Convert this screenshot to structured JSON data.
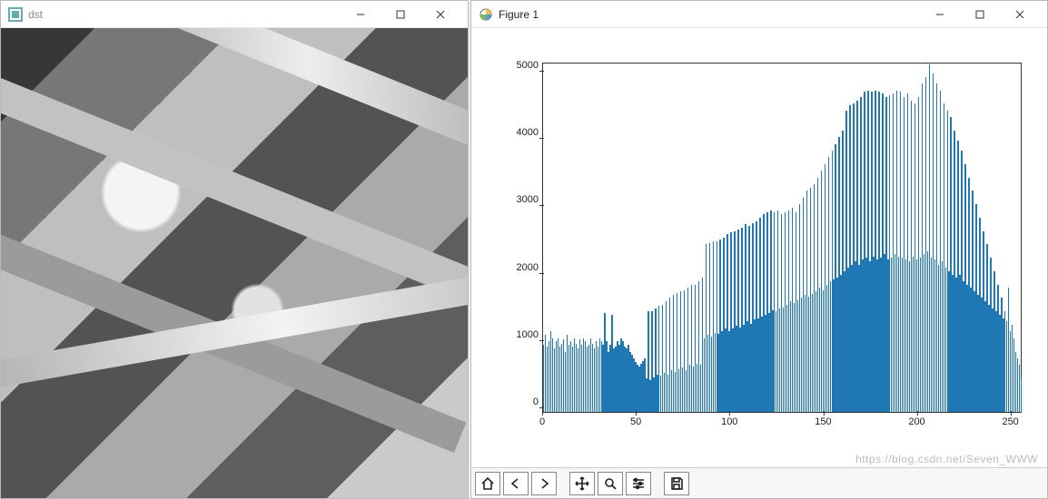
{
  "left_window": {
    "title": "dst",
    "icon_name": "opencv-window-icon"
  },
  "right_window": {
    "title": "Figure 1",
    "icon_name": "matplotlib-figure-icon"
  },
  "window_controls": {
    "minimize": "Minimize",
    "maximize": "Maximize",
    "close": "Close"
  },
  "toolbar": {
    "home": "Home",
    "back": "Back",
    "forward": "Forward",
    "pan": "Pan",
    "zoom": "Zoom",
    "configure": "Configure subplots",
    "save": "Save"
  },
  "watermark": "https://blog.csdn.net/Seven_WWW",
  "chart_data": {
    "type": "bar",
    "title": "",
    "xlabel": "",
    "ylabel": "",
    "xlim": [
      0,
      256
    ],
    "ylim": [
      0,
      5200
    ],
    "xticks": [
      0,
      50,
      100,
      150,
      200,
      250
    ],
    "yticks": [
      0,
      1000,
      2000,
      3000,
      4000,
      5000
    ],
    "x": [
      0,
      1,
      2,
      3,
      4,
      5,
      6,
      7,
      8,
      9,
      10,
      11,
      12,
      13,
      14,
      15,
      16,
      17,
      18,
      19,
      20,
      21,
      22,
      23,
      24,
      25,
      26,
      27,
      28,
      29,
      30,
      31,
      32,
      33,
      34,
      35,
      36,
      37,
      38,
      39,
      40,
      41,
      42,
      43,
      44,
      45,
      46,
      47,
      48,
      49,
      50,
      51,
      52,
      53,
      54,
      55,
      56,
      57,
      58,
      59,
      60,
      61,
      62,
      63,
      64,
      65,
      66,
      67,
      68,
      69,
      70,
      71,
      72,
      73,
      74,
      75,
      76,
      77,
      78,
      79,
      80,
      81,
      82,
      83,
      84,
      85,
      86,
      87,
      88,
      89,
      90,
      91,
      92,
      93,
      94,
      95,
      96,
      97,
      98,
      99,
      100,
      101,
      102,
      103,
      104,
      105,
      106,
      107,
      108,
      109,
      110,
      111,
      112,
      113,
      114,
      115,
      116,
      117,
      118,
      119,
      120,
      121,
      122,
      123,
      124,
      125,
      126,
      127,
      128,
      129,
      130,
      131,
      132,
      133,
      134,
      135,
      136,
      137,
      138,
      139,
      140,
      141,
      142,
      143,
      144,
      145,
      146,
      147,
      148,
      149,
      150,
      151,
      152,
      153,
      154,
      155,
      156,
      157,
      158,
      159,
      160,
      161,
      162,
      163,
      164,
      165,
      166,
      167,
      168,
      169,
      170,
      171,
      172,
      173,
      174,
      175,
      176,
      177,
      178,
      179,
      180,
      181,
      182,
      183,
      184,
      185,
      186,
      187,
      188,
      189,
      190,
      191,
      192,
      193,
      194,
      195,
      196,
      197,
      198,
      199,
      200,
      201,
      202,
      203,
      204,
      205,
      206,
      207,
      208,
      209,
      210,
      211,
      212,
      213,
      214,
      215,
      216,
      217,
      218,
      219,
      220,
      221,
      222,
      223,
      224,
      225,
      226,
      227,
      228,
      229,
      230,
      231,
      232,
      233,
      234,
      235,
      236,
      237,
      238,
      239,
      240,
      241,
      242,
      243,
      244,
      245,
      246,
      247,
      248,
      249,
      250,
      251,
      252,
      253,
      254,
      255
    ],
    "values": [
      1000,
      1150,
      980,
      1050,
      1200,
      1100,
      950,
      1050,
      1100,
      970,
      1020,
      1080,
      900,
      1150,
      1000,
      1050,
      980,
      1100,
      1020,
      950,
      1080,
      1000,
      1100,
      1050,
      980,
      1000,
      1100,
      1020,
      950,
      1050,
      980,
      1100,
      1050,
      1000,
      1480,
      1050,
      900,
      1000,
      1450,
      950,
      980,
      1050,
      1000,
      1100,
      1050,
      980,
      950,
      1000,
      900,
      850,
      800,
      750,
      700,
      680,
      720,
      760,
      800,
      500,
      1500,
      480,
      1500,
      520,
      1550,
      560,
      1580,
      540,
      1600,
      580,
      1650,
      560,
      1700,
      620,
      1750,
      600,
      1780,
      640,
      1800,
      660,
      1820,
      620,
      1850,
      700,
      1900,
      680,
      1900,
      720,
      1950,
      700,
      2000,
      1100,
      2500,
      1150,
      2520,
      1120,
      2540,
      1180,
      2550,
      1160,
      2570,
      1200,
      2600,
      1250,
      2650,
      1200,
      2680,
      1240,
      2700,
      1280,
      2720,
      1260,
      2750,
      1300,
      2800,
      1350,
      2780,
      1320,
      2820,
      1380,
      2850,
      1400,
      2900,
      1420,
      2950,
      1450,
      2980,
      1480,
      3000,
      1520,
      2980,
      1500,
      3000,
      1540,
      2950,
      1560,
      2980,
      1600,
      3000,
      1650,
      3050,
      1620,
      2980,
      1660,
      3100,
      1700,
      3200,
      1750,
      3300,
      1720,
      3350,
      1760,
      3400,
      1800,
      3500,
      1850,
      3600,
      1820,
      3700,
      1900,
      3800,
      1950,
      3900,
      1980,
      4000,
      2000,
      4100,
      2050,
      4200,
      2100,
      4500,
      2150,
      4580,
      2200,
      4600,
      2250,
      4650,
      2200,
      4700,
      2280,
      4780,
      2300,
      4800,
      2250,
      4780,
      2320,
      4800,
      2280,
      4780,
      2300,
      4750,
      2350,
      4700,
      2280,
      4720,
      2300,
      4750,
      2350,
      4800,
      2320,
      4780,
      2300,
      4700,
      2280,
      4750,
      2250,
      4650,
      2320,
      4600,
      2280,
      4700,
      2300,
      4900,
      2350,
      5000,
      2400,
      5180,
      2300,
      5050,
      2280,
      4900,
      2200,
      4800,
      2250,
      4600,
      2150,
      4500,
      2100,
      4400,
      2050,
      4200,
      2000,
      4050,
      2050,
      3900,
      1950,
      3700,
      1900,
      3500,
      1850,
      3300,
      1800,
      3100,
      1750,
      2900,
      1700,
      2700,
      1650,
      2500,
      1600,
      2300,
      1550,
      2100,
      1500,
      1900,
      1450,
      1700,
      1400,
      1500,
      1350,
      1850,
      1200,
      1300,
      1100,
      900,
      800,
      700,
      500
    ]
  }
}
